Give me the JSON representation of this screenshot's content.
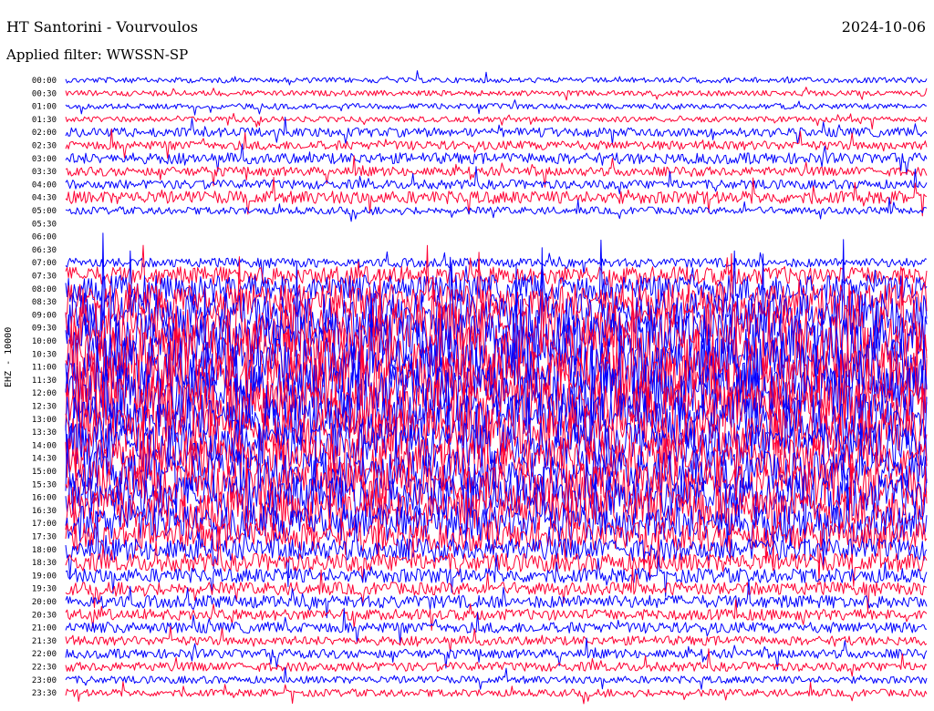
{
  "header": {
    "station": "HT Santorini - Vourvoulos",
    "date": "2024-10-06",
    "filter": "Applied filter: WWSSN-SP"
  },
  "colors": {
    "blue": "#0000ff",
    "red": "#ff0033"
  },
  "chart_data": {
    "type": "line",
    "ylabel": "EHZ - 10000",
    "row_labels": [
      "00:00",
      "00:30",
      "01:00",
      "01:30",
      "02:00",
      "02:30",
      "03:00",
      "03:30",
      "04:00",
      "04:30",
      "05:00",
      "05:30",
      "06:00",
      "06:30",
      "07:00",
      "07:30",
      "08:00",
      "08:30",
      "09:00",
      "09:30",
      "10:00",
      "10:30",
      "11:00",
      "11:30",
      "12:00",
      "12:30",
      "13:00",
      "13:30",
      "14:00",
      "14:30",
      "15:00",
      "15:30",
      "16:00",
      "16:30",
      "17:00",
      "17:30",
      "18:00",
      "18:30",
      "19:00",
      "19:30",
      "20:00",
      "20:30",
      "21:00",
      "21:30",
      "22:00",
      "22:30",
      "23:00",
      "23:30"
    ],
    "row_colors": [
      "blue",
      "red"
    ],
    "row_amplitudes": [
      3,
      3,
      3,
      3,
      5,
      5,
      6,
      5,
      5,
      7,
      4,
      0,
      0,
      0,
      5,
      10,
      15,
      20,
      24,
      27,
      30,
      30,
      32,
      32,
      32,
      30,
      28,
      26,
      24,
      22,
      22,
      24,
      24,
      22,
      20,
      16,
      12,
      10,
      8,
      7,
      7,
      6,
      6,
      5,
      5,
      5,
      4,
      4
    ],
    "gaps": [
      {
        "row": "05:30",
        "from_min": 0,
        "to_min": 30
      },
      {
        "row": "06:00",
        "from_min": 0,
        "to_min": 30
      },
      {
        "row": "06:30",
        "from_min": 0,
        "to_min": 18
      }
    ]
  }
}
